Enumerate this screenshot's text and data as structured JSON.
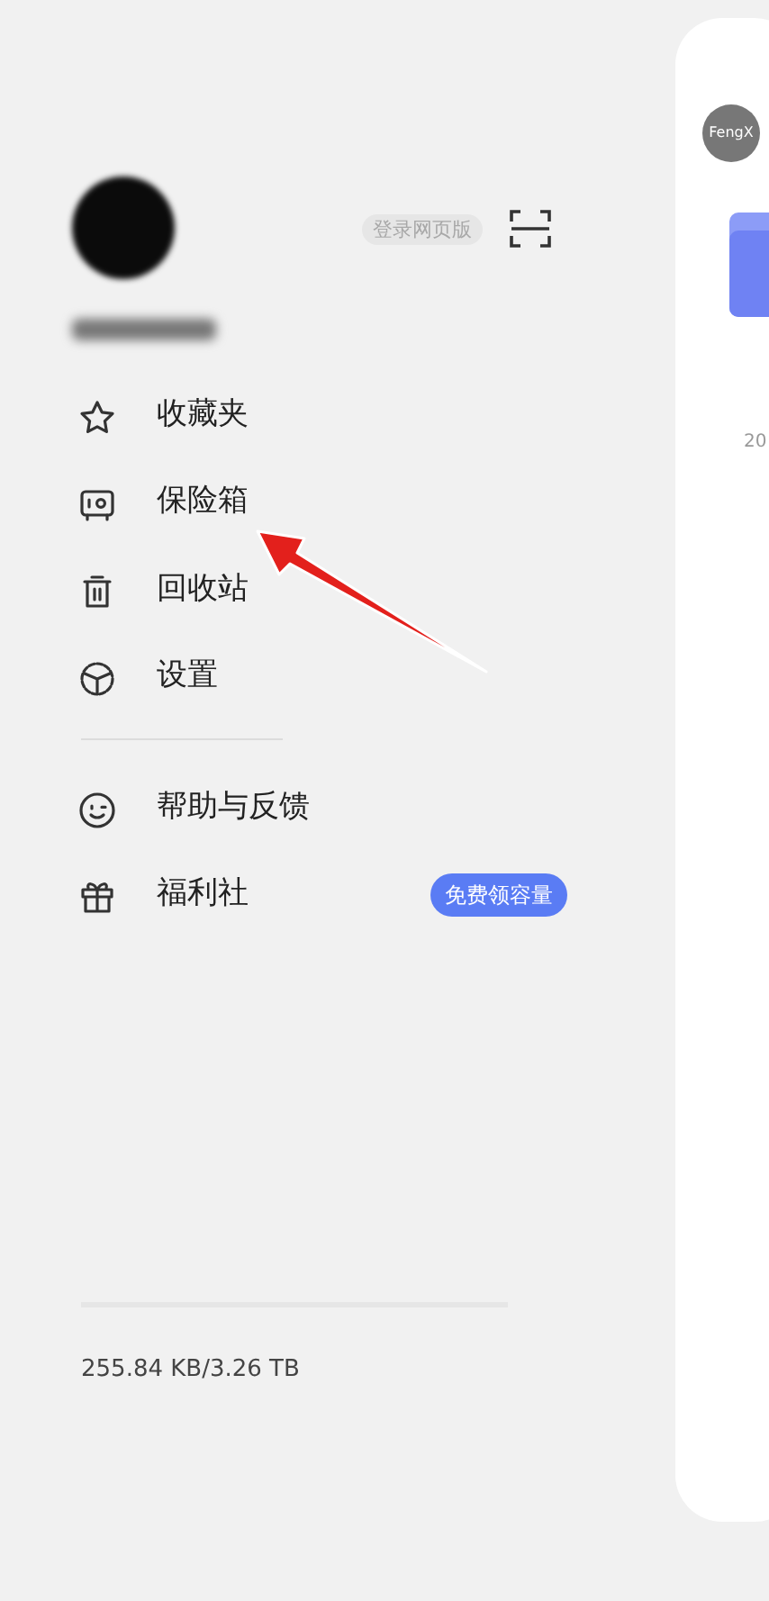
{
  "profile": {
    "login_web_button": "登录网页版"
  },
  "menu": [
    {
      "label": "收藏夹"
    },
    {
      "label": "保险箱"
    },
    {
      "label": "回收站"
    },
    {
      "label": "设置"
    },
    {
      "label": "帮助与反馈"
    },
    {
      "label": "福利社",
      "badge": "免费领容量"
    }
  ],
  "storage": {
    "reading": "255.84 KB/3.26 TB"
  },
  "main_panel": {
    "avatar_text": "FengX",
    "item_date": "20"
  }
}
